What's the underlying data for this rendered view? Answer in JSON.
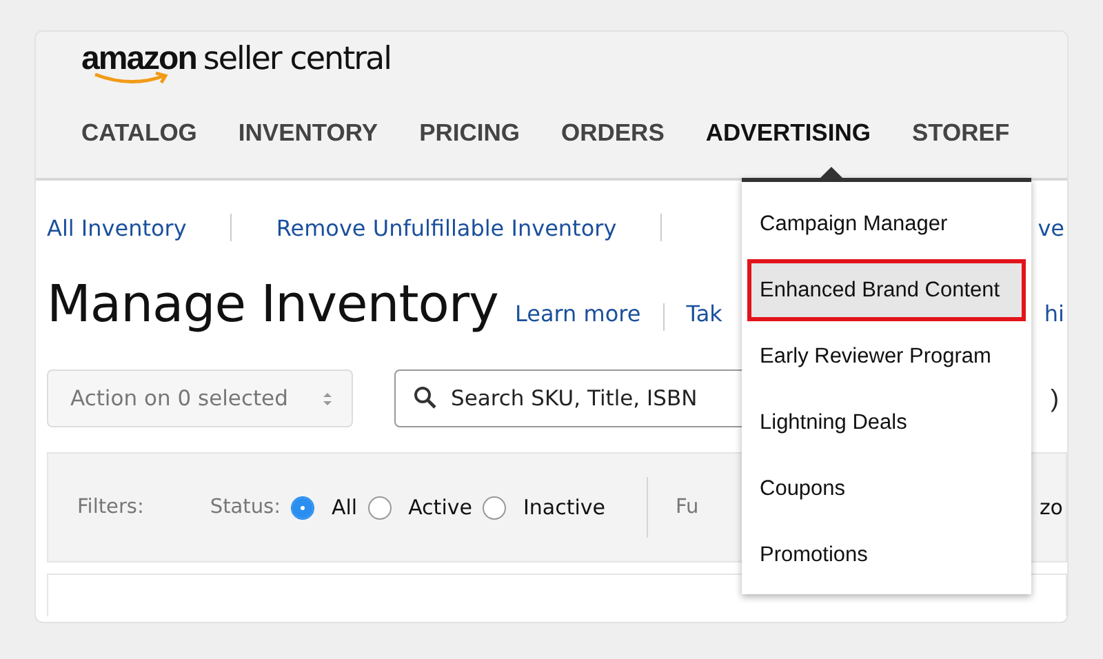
{
  "logo": {
    "brand": "amazon",
    "product": "seller central"
  },
  "nav": [
    {
      "label": "CATALOG",
      "selected": false
    },
    {
      "label": "INVENTORY",
      "selected": false
    },
    {
      "label": "PRICING",
      "selected": false
    },
    {
      "label": "ORDERS",
      "selected": false
    },
    {
      "label": "ADVERTISING",
      "selected": true
    },
    {
      "label": "STOREF",
      "selected": false
    }
  ],
  "sub_links": [
    "All Inventory",
    "Remove Unfulfillable Inventory"
  ],
  "sub_links_partial": "ve",
  "page_title": "Manage Inventory",
  "title_links": [
    "Learn more",
    "Tak"
  ],
  "title_links_partial": "hi",
  "action_select": {
    "value": "Action on 0 selected"
  },
  "search": {
    "placeholder": "Search SKU, Title, ISBN"
  },
  "search_row_partial": ")",
  "filters": {
    "label": "Filters:",
    "status_label": "Status:",
    "options": [
      {
        "label": "All",
        "selected": true
      },
      {
        "label": "Active",
        "selected": false
      },
      {
        "label": "Inactive",
        "selected": false
      }
    ],
    "next_label_partial": "Fu",
    "right_partial": "zo"
  },
  "dropdown": [
    {
      "label": "Campaign Manager",
      "selected": false
    },
    {
      "label": "Enhanced Brand Content",
      "selected": true
    },
    {
      "label": "Early Reviewer Program",
      "selected": false
    },
    {
      "label": "Lightning Deals",
      "selected": false
    },
    {
      "label": "Coupons",
      "selected": false
    },
    {
      "label": "Promotions",
      "selected": false
    }
  ]
}
